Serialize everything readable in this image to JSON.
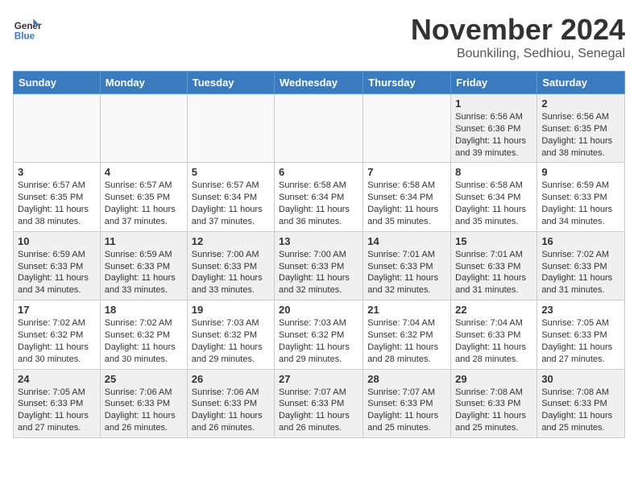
{
  "header": {
    "logo_line1": "General",
    "logo_line2": "Blue",
    "month_title": "November 2024",
    "location": "Bounkiling, Sedhiou, Senegal"
  },
  "weekdays": [
    "Sunday",
    "Monday",
    "Tuesday",
    "Wednesday",
    "Thursday",
    "Friday",
    "Saturday"
  ],
  "weeks": [
    [
      {
        "day": "",
        "info": "",
        "empty": true
      },
      {
        "day": "",
        "info": "",
        "empty": true
      },
      {
        "day": "",
        "info": "",
        "empty": true
      },
      {
        "day": "",
        "info": "",
        "empty": true
      },
      {
        "day": "",
        "info": "",
        "empty": true
      },
      {
        "day": "1",
        "info": "Sunrise: 6:56 AM\nSunset: 6:36 PM\nDaylight: 11 hours and 39 minutes.",
        "empty": false
      },
      {
        "day": "2",
        "info": "Sunrise: 6:56 AM\nSunset: 6:35 PM\nDaylight: 11 hours and 38 minutes.",
        "empty": false
      }
    ],
    [
      {
        "day": "3",
        "info": "Sunrise: 6:57 AM\nSunset: 6:35 PM\nDaylight: 11 hours and 38 minutes.",
        "empty": false
      },
      {
        "day": "4",
        "info": "Sunrise: 6:57 AM\nSunset: 6:35 PM\nDaylight: 11 hours and 37 minutes.",
        "empty": false
      },
      {
        "day": "5",
        "info": "Sunrise: 6:57 AM\nSunset: 6:34 PM\nDaylight: 11 hours and 37 minutes.",
        "empty": false
      },
      {
        "day": "6",
        "info": "Sunrise: 6:58 AM\nSunset: 6:34 PM\nDaylight: 11 hours and 36 minutes.",
        "empty": false
      },
      {
        "day": "7",
        "info": "Sunrise: 6:58 AM\nSunset: 6:34 PM\nDaylight: 11 hours and 35 minutes.",
        "empty": false
      },
      {
        "day": "8",
        "info": "Sunrise: 6:58 AM\nSunset: 6:34 PM\nDaylight: 11 hours and 35 minutes.",
        "empty": false
      },
      {
        "day": "9",
        "info": "Sunrise: 6:59 AM\nSunset: 6:33 PM\nDaylight: 11 hours and 34 minutes.",
        "empty": false
      }
    ],
    [
      {
        "day": "10",
        "info": "Sunrise: 6:59 AM\nSunset: 6:33 PM\nDaylight: 11 hours and 34 minutes.",
        "empty": false
      },
      {
        "day": "11",
        "info": "Sunrise: 6:59 AM\nSunset: 6:33 PM\nDaylight: 11 hours and 33 minutes.",
        "empty": false
      },
      {
        "day": "12",
        "info": "Sunrise: 7:00 AM\nSunset: 6:33 PM\nDaylight: 11 hours and 33 minutes.",
        "empty": false
      },
      {
        "day": "13",
        "info": "Sunrise: 7:00 AM\nSunset: 6:33 PM\nDaylight: 11 hours and 32 minutes.",
        "empty": false
      },
      {
        "day": "14",
        "info": "Sunrise: 7:01 AM\nSunset: 6:33 PM\nDaylight: 11 hours and 32 minutes.",
        "empty": false
      },
      {
        "day": "15",
        "info": "Sunrise: 7:01 AM\nSunset: 6:33 PM\nDaylight: 11 hours and 31 minutes.",
        "empty": false
      },
      {
        "day": "16",
        "info": "Sunrise: 7:02 AM\nSunset: 6:33 PM\nDaylight: 11 hours and 31 minutes.",
        "empty": false
      }
    ],
    [
      {
        "day": "17",
        "info": "Sunrise: 7:02 AM\nSunset: 6:32 PM\nDaylight: 11 hours and 30 minutes.",
        "empty": false
      },
      {
        "day": "18",
        "info": "Sunrise: 7:02 AM\nSunset: 6:32 PM\nDaylight: 11 hours and 30 minutes.",
        "empty": false
      },
      {
        "day": "19",
        "info": "Sunrise: 7:03 AM\nSunset: 6:32 PM\nDaylight: 11 hours and 29 minutes.",
        "empty": false
      },
      {
        "day": "20",
        "info": "Sunrise: 7:03 AM\nSunset: 6:32 PM\nDaylight: 11 hours and 29 minutes.",
        "empty": false
      },
      {
        "day": "21",
        "info": "Sunrise: 7:04 AM\nSunset: 6:32 PM\nDaylight: 11 hours and 28 minutes.",
        "empty": false
      },
      {
        "day": "22",
        "info": "Sunrise: 7:04 AM\nSunset: 6:33 PM\nDaylight: 11 hours and 28 minutes.",
        "empty": false
      },
      {
        "day": "23",
        "info": "Sunrise: 7:05 AM\nSunset: 6:33 PM\nDaylight: 11 hours and 27 minutes.",
        "empty": false
      }
    ],
    [
      {
        "day": "24",
        "info": "Sunrise: 7:05 AM\nSunset: 6:33 PM\nDaylight: 11 hours and 27 minutes.",
        "empty": false
      },
      {
        "day": "25",
        "info": "Sunrise: 7:06 AM\nSunset: 6:33 PM\nDaylight: 11 hours and 26 minutes.",
        "empty": false
      },
      {
        "day": "26",
        "info": "Sunrise: 7:06 AM\nSunset: 6:33 PM\nDaylight: 11 hours and 26 minutes.",
        "empty": false
      },
      {
        "day": "27",
        "info": "Sunrise: 7:07 AM\nSunset: 6:33 PM\nDaylight: 11 hours and 26 minutes.",
        "empty": false
      },
      {
        "day": "28",
        "info": "Sunrise: 7:07 AM\nSunset: 6:33 PM\nDaylight: 11 hours and 25 minutes.",
        "empty": false
      },
      {
        "day": "29",
        "info": "Sunrise: 7:08 AM\nSunset: 6:33 PM\nDaylight: 11 hours and 25 minutes.",
        "empty": false
      },
      {
        "day": "30",
        "info": "Sunrise: 7:08 AM\nSunset: 6:33 PM\nDaylight: 11 hours and 25 minutes.",
        "empty": false
      }
    ]
  ]
}
